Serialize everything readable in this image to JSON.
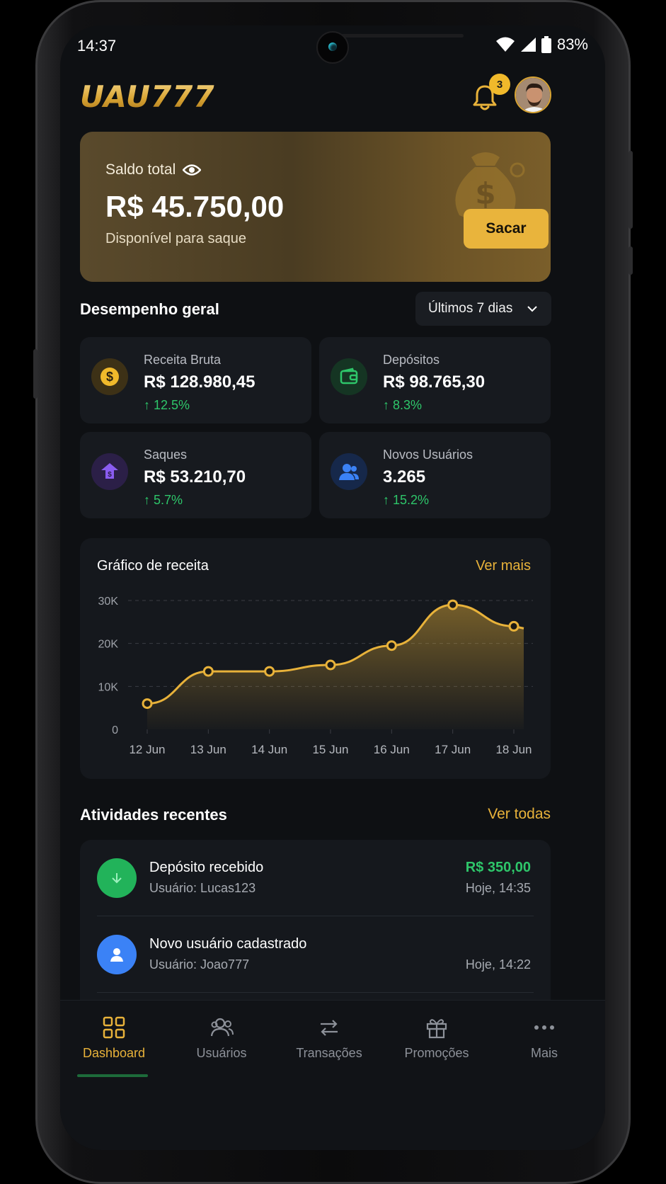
{
  "status_bar": {
    "time": "14:37",
    "battery": "83%"
  },
  "header": {
    "logo": "UAU777",
    "notification_count": "3"
  },
  "balance": {
    "label": "Saldo total",
    "value": "R$ 45.750,00",
    "subtitle": "Disponível para saque",
    "withdraw_label": "Sacar"
  },
  "performance": {
    "title": "Desempenho geral",
    "period": "Últimos 7 dias",
    "stats": [
      {
        "label": "Receita Bruta",
        "value": "R$ 128.980,45",
        "change": "12.5%",
        "icon": "dollar-coin-icon",
        "color": "#f0b92b"
      },
      {
        "label": "Depósitos",
        "value": "R$ 98.765,30",
        "change": "8.3%",
        "icon": "wallet-icon",
        "color": "#2ec66a"
      },
      {
        "label": "Saques",
        "value": "R$ 53.210,70",
        "change": "5.7%",
        "icon": "withdraw-icon",
        "color": "#8a5cf0"
      },
      {
        "label": "Novos Usuários",
        "value": "3.265",
        "change": "15.2%",
        "icon": "users-icon",
        "color": "#3b82f6"
      }
    ]
  },
  "revenue_chart": {
    "title": "Gráfico de receita",
    "link": "Ver mais"
  },
  "chart_data": {
    "type": "area",
    "categories": [
      "12 Jun",
      "13 Jun",
      "14 Jun",
      "15 Jun",
      "16 Jun",
      "17 Jun",
      "18 Jun"
    ],
    "values": [
      6000,
      13500,
      13500,
      15000,
      19500,
      29000,
      24000
    ],
    "y_ticks": [
      "0",
      "10K",
      "20K",
      "30K"
    ],
    "ylim": [
      0,
      30000
    ],
    "grid": true,
    "color": "#e8b23a"
  },
  "activities": {
    "title": "Atividades recentes",
    "link": "Ver todas",
    "items": [
      {
        "title": "Depósito recebido",
        "user": "Usuário: Lucas123",
        "amount": "R$ 350,00",
        "time": "Hoje, 14:35",
        "icon": "arrow-down-icon",
        "color": "#2ec66a"
      },
      {
        "title": "Novo usuário cadastrado",
        "user": "Usuário: Joao777",
        "amount": "",
        "time": "Hoje, 14:22",
        "icon": "user-icon",
        "color": "#3b82f6"
      }
    ]
  },
  "nav": [
    {
      "label": "Dashboard",
      "icon": "dashboard-grid-icon",
      "active": true
    },
    {
      "label": "Usuários",
      "icon": "users-icon",
      "active": false
    },
    {
      "label": "Transações",
      "icon": "transfer-arrows-icon",
      "active": false
    },
    {
      "label": "Promoções",
      "icon": "gift-icon",
      "active": false
    },
    {
      "label": "Mais",
      "icon": "more-dots-icon",
      "active": false
    }
  ]
}
